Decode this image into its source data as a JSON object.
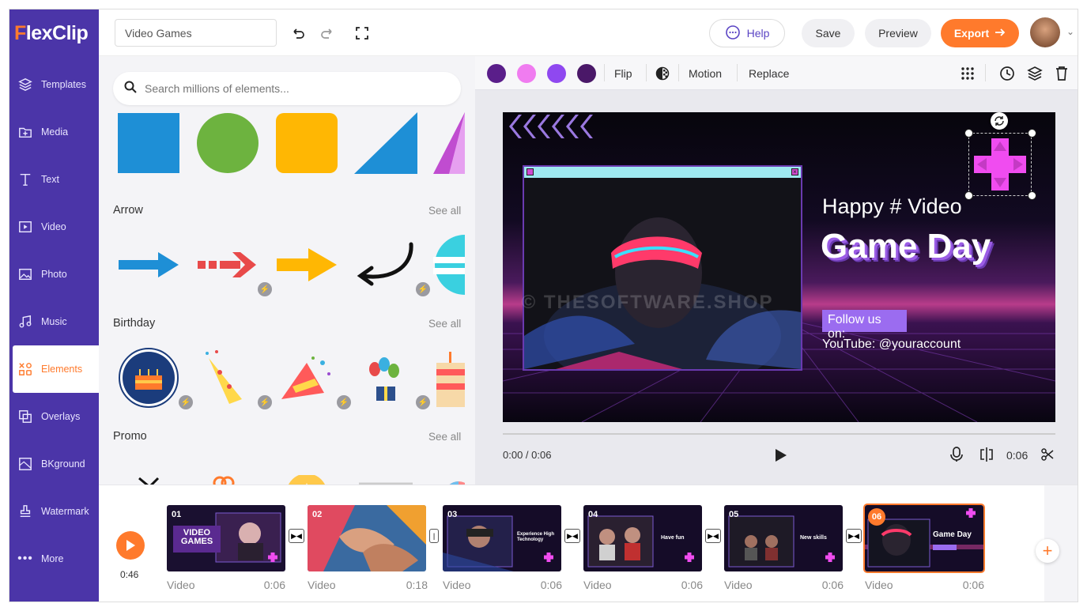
{
  "app": {
    "logo_f": "F",
    "logo_rest": "lexClip"
  },
  "sidebar": {
    "items": [
      {
        "label": "Templates",
        "icon": "layers-icon"
      },
      {
        "label": "Media",
        "icon": "folder-plus-icon"
      },
      {
        "label": "Text",
        "icon": "text-icon"
      },
      {
        "label": "Video",
        "icon": "video-icon"
      },
      {
        "label": "Photo",
        "icon": "photo-icon"
      },
      {
        "label": "Music",
        "icon": "music-icon"
      },
      {
        "label": "Elements",
        "icon": "elements-icon",
        "active": true
      },
      {
        "label": "Overlays",
        "icon": "overlays-icon"
      },
      {
        "label": "BKground",
        "icon": "background-icon"
      },
      {
        "label": "Watermark",
        "icon": "stamp-icon"
      },
      {
        "label": "More",
        "icon": "more-icon"
      }
    ]
  },
  "topbar": {
    "project_name": "Video Games",
    "help_label": "Help",
    "save_label": "Save",
    "preview_label": "Preview",
    "export_label": "Export"
  },
  "panel": {
    "search_placeholder": "Search millions of elements...",
    "sections": [
      {
        "title": "Arrow",
        "see_all": "See all"
      },
      {
        "title": "Birthday",
        "see_all": "See all"
      },
      {
        "title": "Promo",
        "see_all": "See all"
      }
    ]
  },
  "props": {
    "swatches": [
      "#5a1e8a",
      "#f07cf0",
      "#8f48f0",
      "#4a1868"
    ],
    "flip_label": "Flip",
    "motion_label": "Motion",
    "replace_label": "Replace"
  },
  "canvas": {
    "line1": "Happy # Video",
    "line2": "Game Day",
    "follow": "Follow us on:",
    "youtube": "YouTube: @youraccount",
    "watermark": "© THESOFTWARE.SHOP"
  },
  "player": {
    "time_current": "0:00 / 0:06",
    "duration": "0:06"
  },
  "storyboard": {
    "total": "0:46",
    "clips": [
      {
        "num": "01",
        "label": "Video",
        "duration": "0:06",
        "title": "VIDEO GAMES"
      },
      {
        "num": "02",
        "label": "Video",
        "duration": "0:18"
      },
      {
        "num": "03",
        "label": "Video",
        "duration": "0:06",
        "title": "Experience High Technology"
      },
      {
        "num": "04",
        "label": "Video",
        "duration": "0:06",
        "title": "Have fun"
      },
      {
        "num": "05",
        "label": "Video",
        "duration": "0:06",
        "title": "New skills"
      },
      {
        "num": "06",
        "label": "Video",
        "duration": "0:06",
        "title": "Game Day"
      }
    ]
  }
}
